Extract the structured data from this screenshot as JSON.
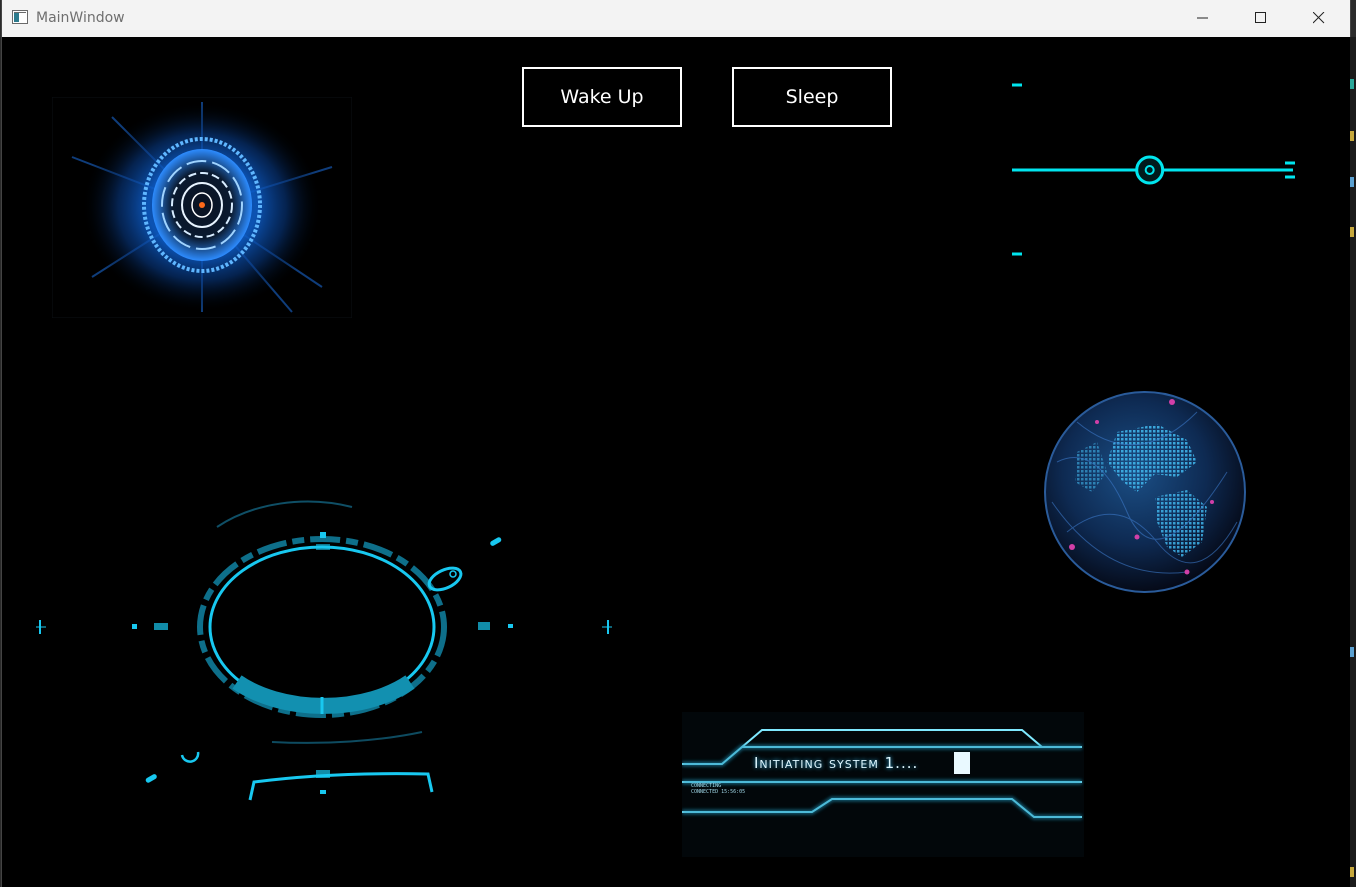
{
  "window": {
    "title": "MainWindow"
  },
  "buttons": {
    "wake_up": "Wake Up",
    "sleep": "Sleep"
  },
  "slider": {
    "value": 0.49
  },
  "status": {
    "message": "Initiating system 1....",
    "log_line_1": "CONNECTING",
    "log_line_2": "CONNECTED 15:56:05"
  },
  "colors": {
    "accent": "#00e5ee",
    "hud_blue": "#18c8f0",
    "button_border": "#ffffff",
    "background": "#000000"
  }
}
